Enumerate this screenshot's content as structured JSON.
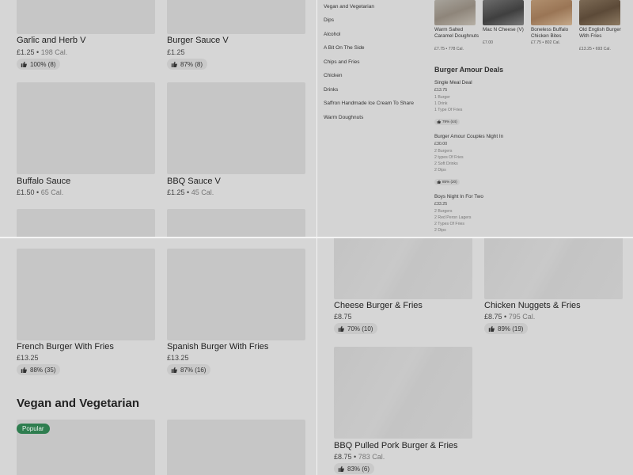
{
  "top_left": {
    "cards": [
      {
        "title": "Garlic and Herb V",
        "price": "£1.25",
        "calories": "198 Cal.",
        "rating": "100% (8)"
      },
      {
        "title": "Burger Sauce V",
        "price": "£1.25",
        "calories": "",
        "rating": "87% (8)"
      },
      {
        "title": "Buffalo Sauce",
        "price": "£1.50",
        "calories": "65 Cal.",
        "rating": ""
      },
      {
        "title": " BBQ Sauce V",
        "price": "£1.25",
        "calories": "45 Cal.",
        "rating": ""
      }
    ]
  },
  "top_right": {
    "menu": [
      "Vegan and Vegetarian",
      "Dips",
      "Alcohol",
      "A Bit On The Side",
      "Chips and Fries",
      "Chicken",
      "Drinks",
      "Saffron Handmade Ice Cream To Share",
      "Warm Doughnuts"
    ],
    "featured": [
      {
        "name": "Warm Salted Caramel Doughnuts",
        "price": "£7.75",
        "calories": "778 Cal."
      },
      {
        "name": "Mac N Cheese (V)",
        "price": "£7.00",
        "calories": ""
      },
      {
        "name": "Boneless Buffalo Chicken Bites",
        "price": "£7.75",
        "calories": "802 Cal."
      },
      {
        "name": "Old English Burger With Fries",
        "price": "£13.25",
        "calories": "693 Cal."
      }
    ],
    "deals_title": "Burger Amour Deals",
    "deals": [
      {
        "name": "Single Meal Deal",
        "price": "£13.75",
        "lines": [
          "1 Burger",
          "1 Drink",
          "1 Type Of Fries"
        ],
        "rating": "79% (44)"
      },
      {
        "name": "Burger Amour Couples Night In",
        "price": "£30.00",
        "lines": [
          "2 Burgers",
          "2 types Of Fries",
          "2 Soft Drinks",
          "2 Dips"
        ],
        "rating": "85% (20)"
      },
      {
        "name": "Boys Night In For Two",
        "price": "£33.25",
        "lines": [
          "2 Burgers",
          "2 Red Peron Lagers",
          "2 Types Of Fries",
          "2 Dips"
        ],
        "rating": ""
      }
    ]
  },
  "bottom_left": {
    "cards": [
      {
        "title": "French Burger With Fries",
        "price": "£13.25",
        "calories": "",
        "rating": "88% (35)"
      },
      {
        "title": "Spanish  Burger With Fries",
        "price": "£13.25",
        "calories": "",
        "rating": "87% (16)"
      }
    ],
    "section_title": "Vegan and Vegetarian",
    "popular_badge": "Popular"
  },
  "bottom_right": {
    "cards": [
      {
        "title": "Cheese Burger & Fries",
        "price": "£8.75",
        "calories": "",
        "rating": "70% (10)"
      },
      {
        "title": "Chicken Nuggets & Fries",
        "price": "£8.75",
        "calories": "795 Cal.",
        "rating": "89% (19)"
      },
      {
        "title": "BBQ Pulled Pork Burger & Fries",
        "price": "£8.75",
        "calories": "783 Cal.",
        "rating": "83% (6)"
      }
    ]
  },
  "icons": {
    "rating": "thumbs-up-icon"
  },
  "colors": {
    "popular_badge": "#2e7d4f",
    "placeholder": "#c6c6c6",
    "background": "#d6d6d6"
  }
}
